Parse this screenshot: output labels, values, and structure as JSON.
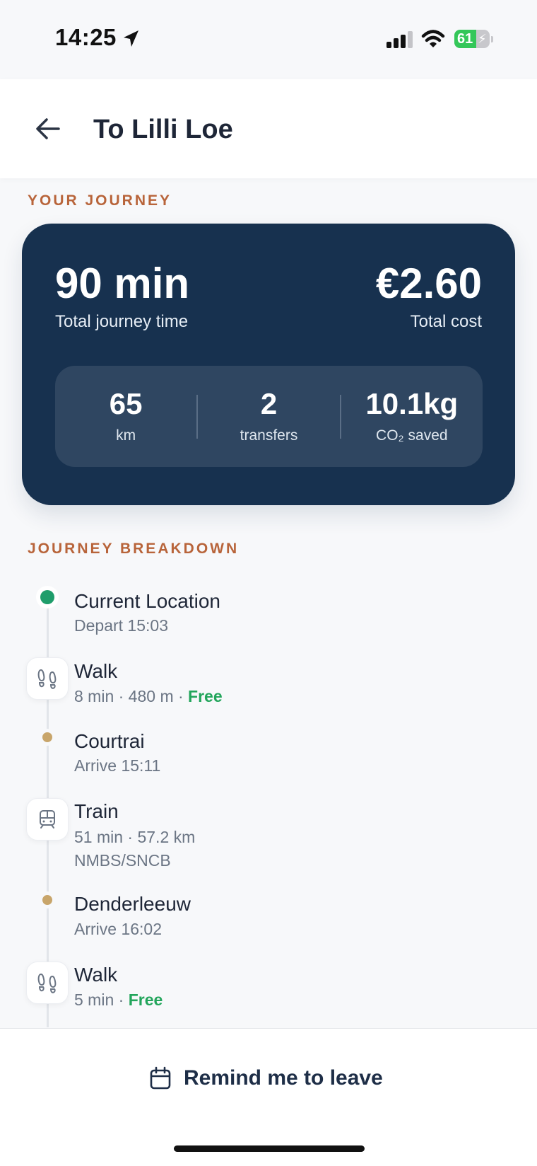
{
  "status_bar": {
    "time": "14:25",
    "battery": "61",
    "battery_level": 0.61,
    "location_icon": "location-arrow-icon",
    "signal_icon": "cellular-signal-icon",
    "wifi_icon": "wifi-icon"
  },
  "header": {
    "back_icon": "arrow-left-icon",
    "title": "To Lilli Loe"
  },
  "your_journey": {
    "section_label": "YOUR JOURNEY",
    "duration": "90 min",
    "duration_label": "Total journey time",
    "cost": "€2.60",
    "cost_label": "Total cost",
    "stats": [
      {
        "value": "65",
        "label": "km"
      },
      {
        "value": "2",
        "label": "transfers"
      },
      {
        "value": "10.1kg",
        "label": "CO₂ saved"
      }
    ]
  },
  "breakdown": {
    "section_label": "JOURNEY BREAKDOWN",
    "steps": [
      {
        "type": "origin",
        "title": "Current Location",
        "sub": "Depart 15:03"
      },
      {
        "type": "walk",
        "icon": "footsteps-icon",
        "title": "Walk",
        "sub": "8 min · 480 m · ",
        "badge": "Free"
      },
      {
        "type": "stop",
        "title": "Courtrai",
        "sub": "Arrive 15:11"
      },
      {
        "type": "train",
        "icon": "train-icon",
        "title": "Train",
        "sub": "51 min · 57.2 km",
        "operator": "NMBS/SNCB"
      },
      {
        "type": "stop",
        "title": "Denderleeuw",
        "sub": "Arrive 16:02"
      },
      {
        "type": "walk",
        "icon": "footsteps-icon",
        "title": "Walk",
        "sub": "5 min · ",
        "badge": "Free"
      }
    ]
  },
  "bottom": {
    "remind_icon": "calendar-icon",
    "remind_label": "Remind me to leave"
  },
  "colors": {
    "card": "#17314f",
    "accent_label": "#b8643a",
    "free": "#22a55b",
    "origin_dot": "#1f9d6b",
    "stop_dot": "#c8a56a"
  }
}
